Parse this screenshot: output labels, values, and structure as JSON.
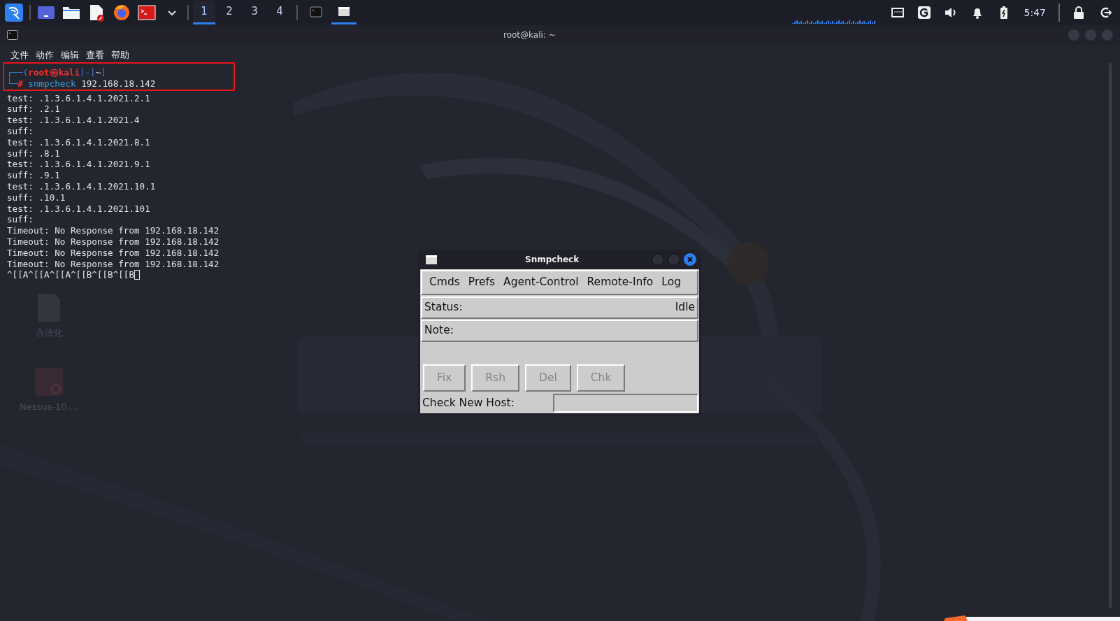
{
  "taskbar": {
    "launchers": [
      {
        "kind": "kali"
      },
      {
        "kind": "desktop"
      },
      {
        "kind": "folder"
      },
      {
        "kind": "editor"
      },
      {
        "kind": "firefox"
      },
      {
        "kind": "terminal"
      },
      {
        "kind": "caret"
      }
    ],
    "workspaces": [
      {
        "label": "1",
        "selected": true
      },
      {
        "label": "2",
        "selected": false
      },
      {
        "label": "3",
        "selected": false
      },
      {
        "label": "4",
        "selected": false
      }
    ],
    "tasks": [
      {
        "kind": "terminal",
        "selected": false
      },
      {
        "kind": "window",
        "selected": true
      }
    ],
    "tray": [
      {
        "kind": "network"
      },
      {
        "kind": "g"
      },
      {
        "kind": "volume"
      },
      {
        "kind": "bell"
      },
      {
        "kind": "battery"
      }
    ],
    "clock": "5:47",
    "session": [
      {
        "kind": "lock"
      },
      {
        "kind": "logout"
      }
    ]
  },
  "desktop_icons": [
    {
      "label": "合法化",
      "kind": "document"
    },
    {
      "label": "Nessus-10....",
      "kind": "package"
    }
  ],
  "terminal": {
    "title": "root@kali: ~",
    "menu": [
      "文件",
      "动作",
      "编辑",
      "查看",
      "帮助"
    ],
    "prompt": [
      {
        "kind": "frame",
        "text": "┌──("
      },
      {
        "kind": "user",
        "text": "root㉿kali"
      },
      {
        "kind": "frame",
        "text": ")-["
      },
      {
        "kind": "dir",
        "text": "~"
      },
      {
        "kind": "frame",
        "text": "]"
      }
    ],
    "command": {
      "marker": "└─#",
      "name": "snmpcheck",
      "args": "192.168.18.142"
    },
    "output": [
      "test: .1.3.6.1.4.1.2021.2.1",
      "suff: .2.1",
      "test: .1.3.6.1.4.1.2021.4",
      "suff:",
      "test: .1.3.6.1.4.1.2021.8.1",
      "suff: .8.1",
      "test: .1.3.6.1.4.1.2021.9.1",
      "suff: .9.1",
      "test: .1.3.6.1.4.1.2021.10.1",
      "suff: .10.1",
      "test: .1.3.6.1.4.1.2021.101",
      "suff:",
      "Timeout: No Response from 192.168.18.142",
      "Timeout: No Response from 192.168.18.142",
      "Timeout: No Response from 192.168.18.142",
      "Timeout: No Response from 192.168.18.142"
    ],
    "input_line": "^[[A^[[A^[[A^[[B^[[B^[[B"
  },
  "snmpcheck": {
    "title": "Snmpcheck",
    "menu": [
      "Cmds",
      "Prefs",
      "Agent-Control",
      "Remote-Info",
      "Log"
    ],
    "status_label": "Status:",
    "status": "Idle",
    "note_label": "Note:",
    "buttons": [
      {
        "label": "Fix",
        "disabled": true
      },
      {
        "label": "Rsh",
        "disabled": true
      },
      {
        "label": "Del",
        "disabled": true
      },
      {
        "label": "Chk",
        "disabled": true
      }
    ],
    "host_label": "Check New Host:"
  }
}
